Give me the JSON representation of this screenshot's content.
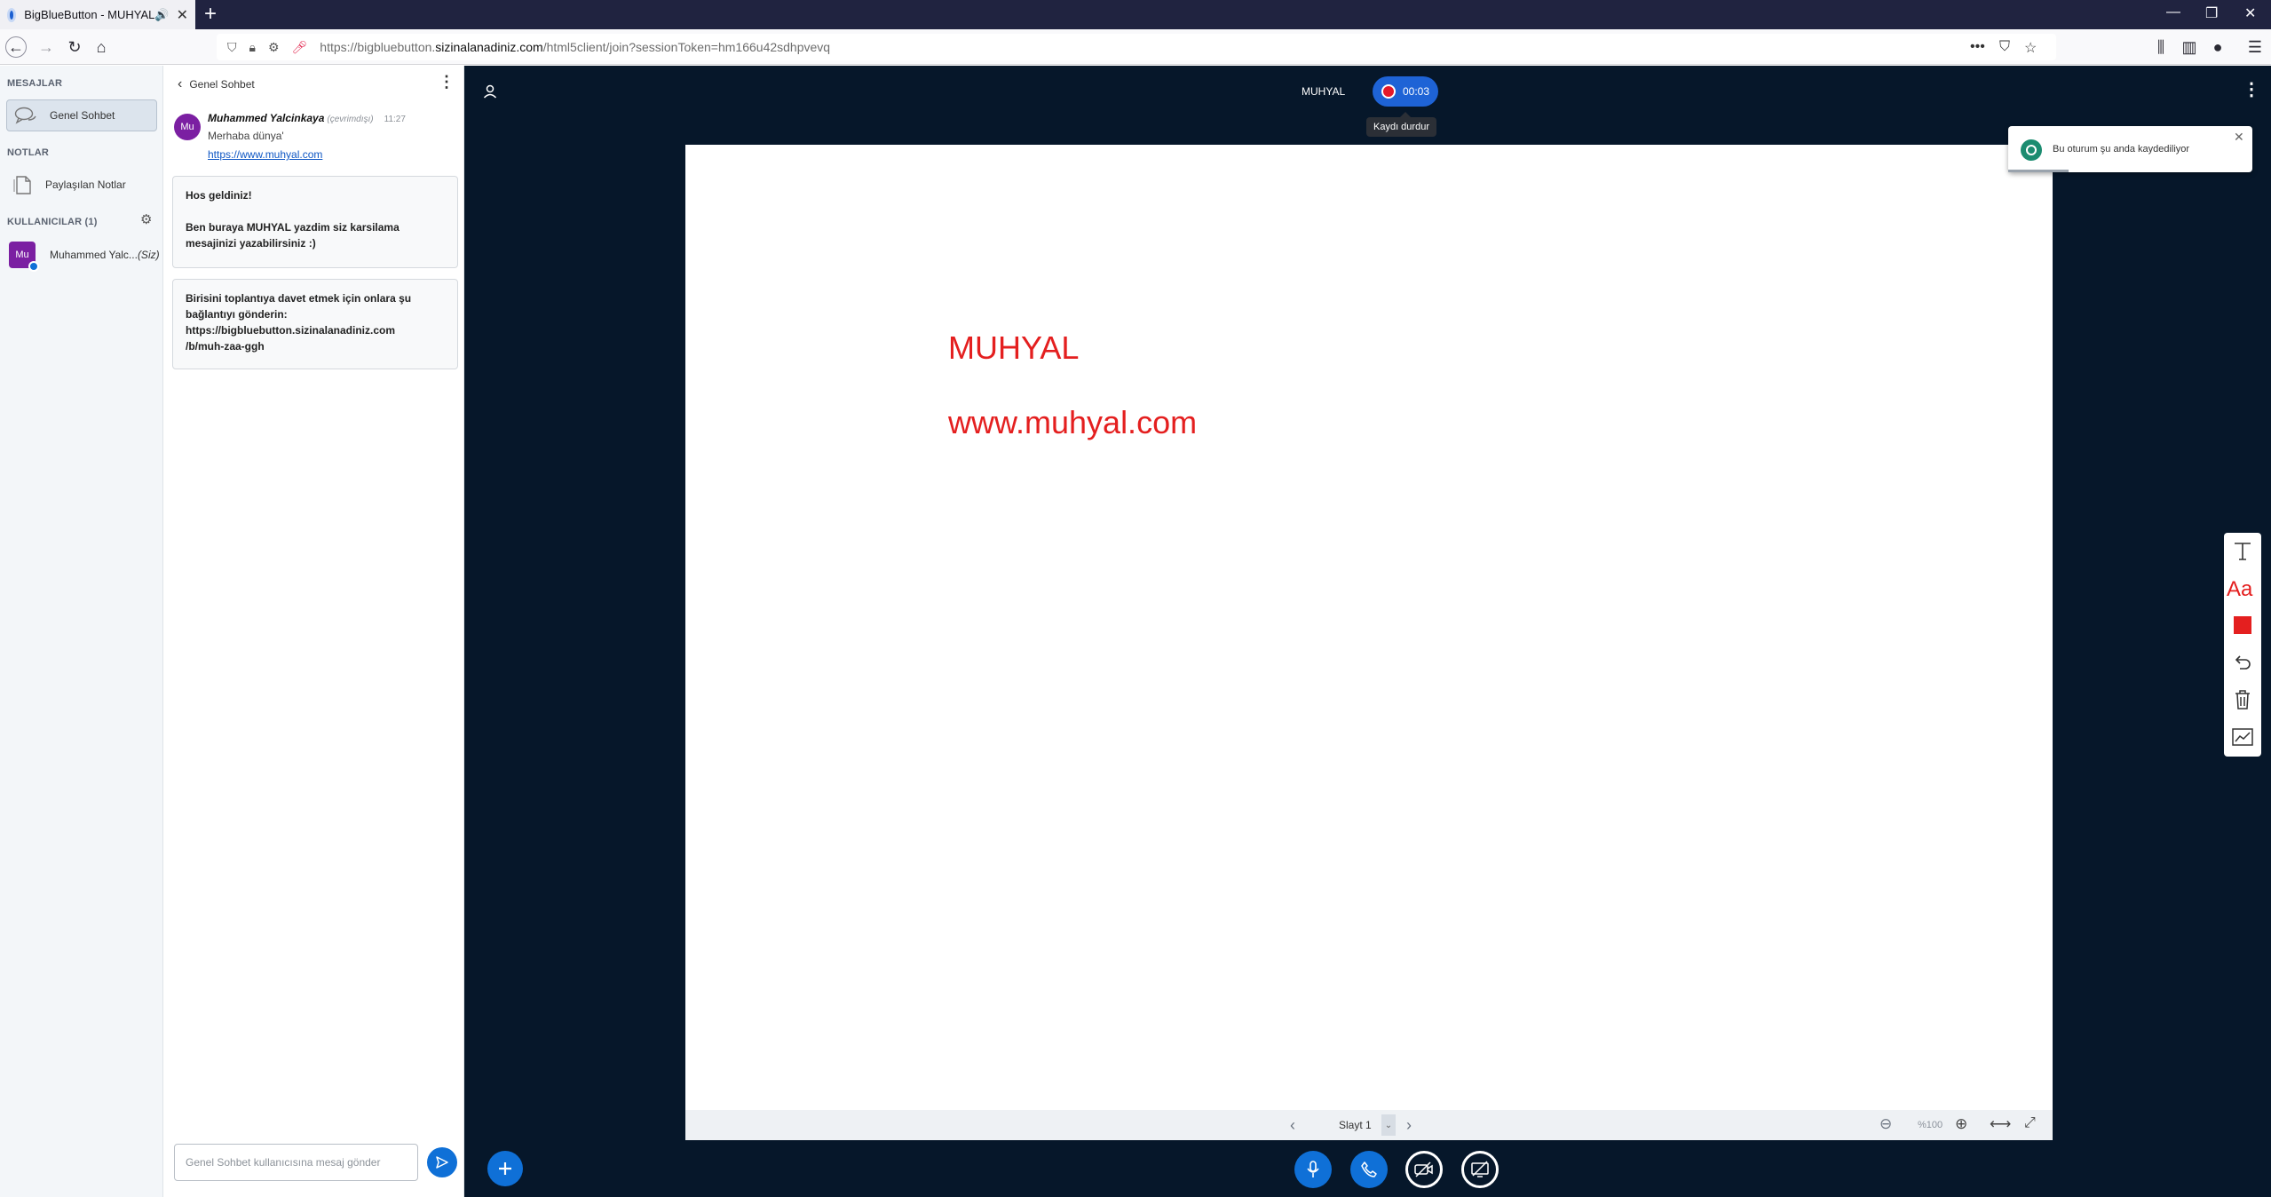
{
  "browser": {
    "tab_title": "BigBlueButton - MUHYAL",
    "url_prefix": "https://bigbluebutton.",
    "url_domain": "sizinalanadiniz.com",
    "url_rest": "/html5client/join?sessionToken=hm166u42sdhpvevq"
  },
  "sidebar": {
    "messages_title": "MESAJLAR",
    "public_chat_label": "Genel Sohbet",
    "notes_title": "NOTLAR",
    "shared_notes_label": "Paylaşılan Notlar",
    "users_title": "KULLANICILAR (1)",
    "user": {
      "initials": "Mu",
      "name": "Muhammed Yalc...",
      "you_label": "(Siz)"
    }
  },
  "chat": {
    "header": "Genel Sohbet",
    "message": {
      "avatar_initials": "Mu",
      "author": "Muhammed Yalcinkaya",
      "status": "(çevrimdışı)",
      "time": "11:27",
      "text": "Merhaba dünya'",
      "link": "https://www.muhyal.com"
    },
    "welcome_text": "Hos geldiniz!\n\nBen buraya MUHYAL yazdim siz karsilama mesajinizi yazabilirsiniz :)",
    "invite_text": "Birisini toplantıya davet etmek için onlara şu bağlantıyı gönderin:\nhttps://bigbluebutton.sizinalanadiniz.com\n/b/muh-zaa-ggh",
    "input_placeholder": "Genel Sohbet kullanıcısına mesaj gönder"
  },
  "stage": {
    "meeting_name": "MUHYAL",
    "recording_time": "00:03",
    "recording_tooltip": "Kaydı durdur",
    "toast_text": "Bu oturum şu anda kaydediliyor",
    "slide_text_1": "MUHYAL",
    "slide_text_2": "www.muhyal.com",
    "slide_label": "Slayt 1",
    "zoom_value": "%100"
  },
  "colors": {
    "accent": "#0f70d7",
    "slide_text": "#e41f1f",
    "stage_bg": "#06172a",
    "avatar": "#7b1fa2",
    "toast_icon": "#1b8c70"
  },
  "icons": [
    "back-icon",
    "forward-icon",
    "reload-icon",
    "home-icon",
    "shield-icon",
    "lock-icon",
    "microphone-icon",
    "user-icon",
    "gear-icon",
    "send-icon",
    "plus-icon",
    "phone-icon",
    "camera-off-icon",
    "screenshare-off-icon",
    "text-tool-icon",
    "font-size-icon",
    "color-icon",
    "undo-icon",
    "trash-icon",
    "multi-user-icon"
  ]
}
